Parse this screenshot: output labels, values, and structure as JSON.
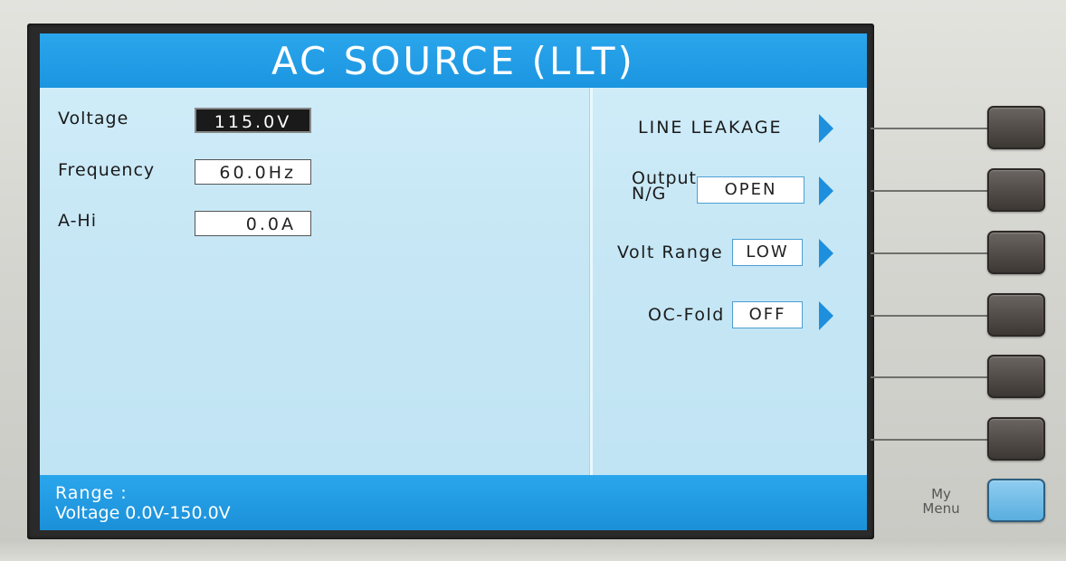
{
  "screen": {
    "title": "AC SOURCE (LLT)"
  },
  "params": [
    {
      "label": "Voltage",
      "value": "115.0V",
      "selected": true
    },
    {
      "label": "Frequency",
      "value": "60.0Hz",
      "selected": false
    },
    {
      "label": "A-Hi",
      "value": "0.0A",
      "selected": false
    }
  ],
  "softkeys": {
    "line_leakage": {
      "label": "LINE LEAKAGE"
    },
    "output_ng": {
      "label_line1": "Output",
      "label_line2": "N/G",
      "value": "OPEN"
    },
    "volt_range": {
      "label": "Volt Range",
      "value": "LOW"
    },
    "oc_fold": {
      "label": "OC-Fold",
      "value": "OFF"
    }
  },
  "status": {
    "line1": "Range :",
    "line2": "Voltage 0.0V-150.0V"
  },
  "hardware": {
    "my_menu_line1": "My",
    "my_menu_line2": "Menu"
  },
  "colors": {
    "title_bar": "#1c95e0",
    "screen_bg": "#c7e7f5",
    "arrow": "#1d8fdc"
  }
}
